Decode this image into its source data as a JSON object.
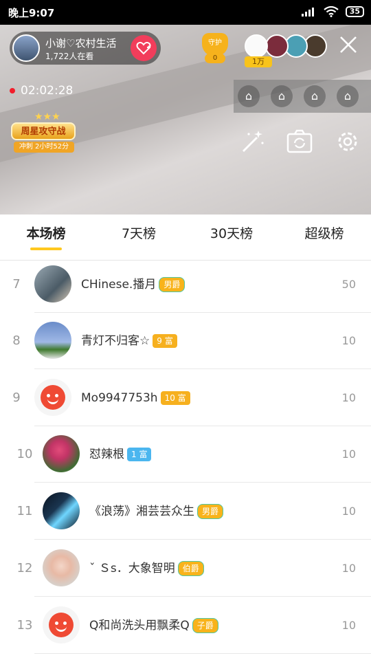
{
  "status_bar": {
    "time": "晚上9:07",
    "battery": "35"
  },
  "live": {
    "host_name": "小谢♡农村生活",
    "viewers": "1,722人在看",
    "guard_label": "守护",
    "guard_count": "0",
    "viewer_badge": "1万",
    "timer": "02:02:28",
    "weekstar_label": "周星攻守战",
    "weekstar_sub": "冲刺 2小时52分"
  },
  "tabs": [
    {
      "label": "本场榜",
      "active": true
    },
    {
      "label": "7天榜",
      "active": false
    },
    {
      "label": "30天榜",
      "active": false
    },
    {
      "label": "超级榜",
      "active": false
    }
  ],
  "ranking": [
    {
      "rank": "7",
      "name": "CHinese.播月",
      "badge": "男爵",
      "badge_type": "gold",
      "score": "50"
    },
    {
      "rank": "8",
      "name": "青灯不归客☆",
      "badge": "9 富",
      "badge_type": "rich",
      "score": "10"
    },
    {
      "rank": "9",
      "name": "Mo9947753h",
      "badge": "10 富",
      "badge_type": "rich",
      "score": "10"
    },
    {
      "rank": "10",
      "name": "怼辣根",
      "badge": "1 富",
      "badge_type": "blue",
      "score": "10"
    },
    {
      "rank": "11",
      "name": "《浪荡》湘芸芸众生",
      "badge": "男爵",
      "badge_type": "gold",
      "score": "10"
    },
    {
      "rank": "12",
      "name": "ˇ Ｓs．大象智明",
      "badge": "伯爵",
      "badge_type": "gold",
      "score": "10"
    },
    {
      "rank": "13",
      "name": "Q和尚洗头用飘柔Q",
      "badge": "子爵",
      "badge_type": "gold",
      "score": "10"
    }
  ],
  "colors": {
    "accent": "#ffc81f",
    "follow": "#f23d5b",
    "live_dot": "#f21d2b"
  }
}
